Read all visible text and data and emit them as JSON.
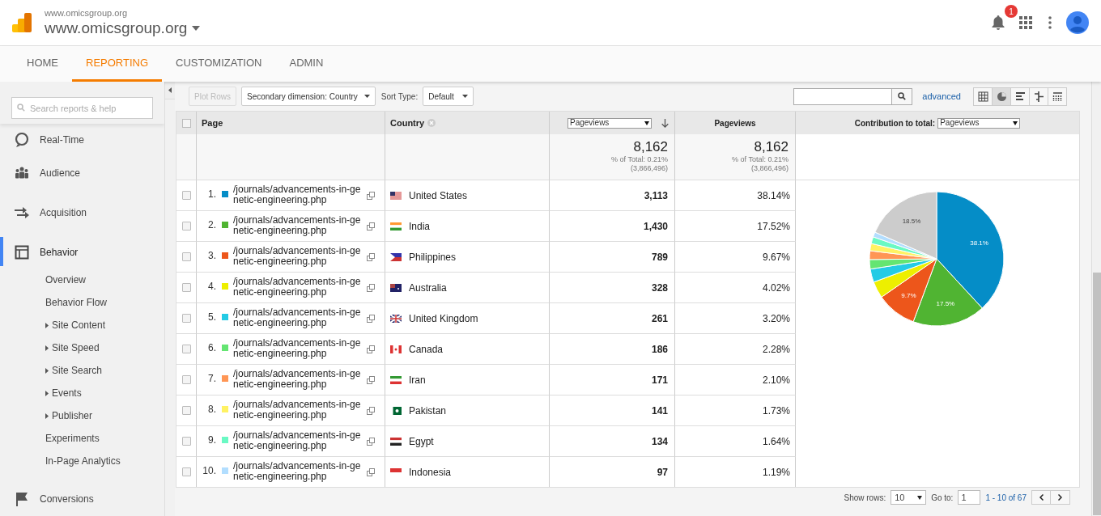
{
  "header": {
    "account": "www.omicsgroup.org",
    "property": "www.omicsgroup.org",
    "notification_count": "1"
  },
  "nav_tabs": [
    {
      "label": "HOME",
      "selected": false
    },
    {
      "label": "REPORTING",
      "selected": true
    },
    {
      "label": "CUSTOMIZATION",
      "selected": false
    },
    {
      "label": "ADMIN",
      "selected": false
    }
  ],
  "sidebar": {
    "search_placeholder": "Search reports & help",
    "items": [
      {
        "label": "Real-Time",
        "kind": "realtime",
        "selected": false
      },
      {
        "label": "Audience",
        "kind": "audience",
        "selected": false
      },
      {
        "label": "Acquisition",
        "kind": "acquisition",
        "selected": false
      },
      {
        "label": "Behavior",
        "kind": "behavior",
        "selected": true,
        "children": [
          {
            "label": "Overview",
            "expandable": false
          },
          {
            "label": "Behavior Flow",
            "expandable": false
          },
          {
            "label": "Site Content",
            "expandable": true
          },
          {
            "label": "Site Speed",
            "expandable": true
          },
          {
            "label": "Site Search",
            "expandable": true
          },
          {
            "label": "Events",
            "expandable": true
          },
          {
            "label": "Publisher",
            "expandable": true
          },
          {
            "label": "Experiments",
            "expandable": false
          },
          {
            "label": "In-Page Analytics",
            "expandable": false
          }
        ]
      },
      {
        "label": "Conversions",
        "kind": "conversions",
        "selected": false
      }
    ]
  },
  "toolbar": {
    "plot_rows": {
      "label": "Plot Rows",
      "disabled": true
    },
    "secondary_dimension": "Secondary dimension: Country",
    "sort_type_label": "Sort Type:",
    "sort_type": "Default",
    "advanced": "advanced",
    "view_buttons": [
      {
        "kind": "table",
        "selected": false
      },
      {
        "kind": "pie",
        "selected": true
      },
      {
        "kind": "bars",
        "selected": false
      },
      {
        "kind": "compare",
        "selected": false
      },
      {
        "kind": "pivot",
        "selected": false
      }
    ]
  },
  "table": {
    "select_all": {
      "checked": false
    },
    "columns": {
      "page": "Page",
      "country": "Country",
      "metric_select": "Pageviews",
      "metric": "Pageviews",
      "contribution_label": "Contribution to total:",
      "contribution_select": "Pageviews"
    },
    "totals": [
      {
        "value": "8,162",
        "share": "% of Total: 0.21%",
        "total": "(3,866,496)"
      },
      {
        "value": "8,162",
        "share": "% of Total: 0.21%",
        "total": "(3,866,496)"
      }
    ],
    "rows": [
      {
        "index": "1.",
        "checked": false,
        "color": "#058dc7",
        "page": "/journals/advancements-in-genetic-engineering.php",
        "country": "United States",
        "pageviews": "3,113",
        "percent": "38.14%"
      },
      {
        "index": "2.",
        "checked": false,
        "color": "#50b432",
        "page": "/journals/advancements-in-genetic-engineering.php",
        "country": "India",
        "pageviews": "1,430",
        "percent": "17.52%"
      },
      {
        "index": "3.",
        "checked": false,
        "color": "#ed561b",
        "page": "/journals/advancements-in-genetic-engineering.php",
        "country": "Philippines",
        "pageviews": "789",
        "percent": "9.67%"
      },
      {
        "index": "4.",
        "checked": false,
        "color": "#edef00",
        "page": "/journals/advancements-in-genetic-engineering.php",
        "country": "Australia",
        "pageviews": "328",
        "percent": "4.02%"
      },
      {
        "index": "5.",
        "checked": false,
        "color": "#24cbe5",
        "page": "/journals/advancements-in-genetic-engineering.php",
        "country": "United Kingdom",
        "pageviews": "261",
        "percent": "3.20%"
      },
      {
        "index": "6.",
        "checked": false,
        "color": "#64e572",
        "page": "/journals/advancements-in-genetic-engineering.php",
        "country": "Canada",
        "pageviews": "186",
        "percent": "2.28%"
      },
      {
        "index": "7.",
        "checked": false,
        "color": "#ff9655",
        "page": "/journals/advancements-in-genetic-engineering.php",
        "country": "Iran",
        "pageviews": "171",
        "percent": "2.10%"
      },
      {
        "index": "8.",
        "checked": false,
        "color": "#fff263",
        "page": "/journals/advancements-in-genetic-engineering.php",
        "country": "Pakistan",
        "pageviews": "141",
        "percent": "1.73%"
      },
      {
        "index": "9.",
        "checked": false,
        "color": "#6af9c4",
        "page": "/journals/advancements-in-genetic-engineering.php",
        "country": "Egypt",
        "pageviews": "134",
        "percent": "1.64%"
      },
      {
        "index": "10.",
        "checked": false,
        "color": "#b2deff",
        "page": "/journals/advancements-in-genetic-engineering.php",
        "country": "Indonesia",
        "pageviews": "97",
        "percent": "1.19%"
      }
    ],
    "chart_data": {
      "type": "pie",
      "values": [
        38.14,
        17.52,
        9.67,
        4.02,
        3.2,
        2.28,
        2.1,
        1.73,
        1.64,
        1.19,
        18.51
      ],
      "colors": [
        "#058dc7",
        "#50b432",
        "#ed561b",
        "#edef00",
        "#24cbe5",
        "#64e572",
        "#ff9655",
        "#fff263",
        "#6af9c4",
        "#b2deff",
        "#cccccc"
      ],
      "value_labels": [
        "38.1%",
        "17.5%",
        "9.7%",
        null,
        null,
        null,
        null,
        null,
        null,
        null,
        "18.5%"
      ]
    }
  },
  "pagination": {
    "show_rows_label": "Show rows:",
    "show_rows": "10",
    "goto_label": "Go to:",
    "goto": "1",
    "range": "1 - 10 of 67"
  }
}
